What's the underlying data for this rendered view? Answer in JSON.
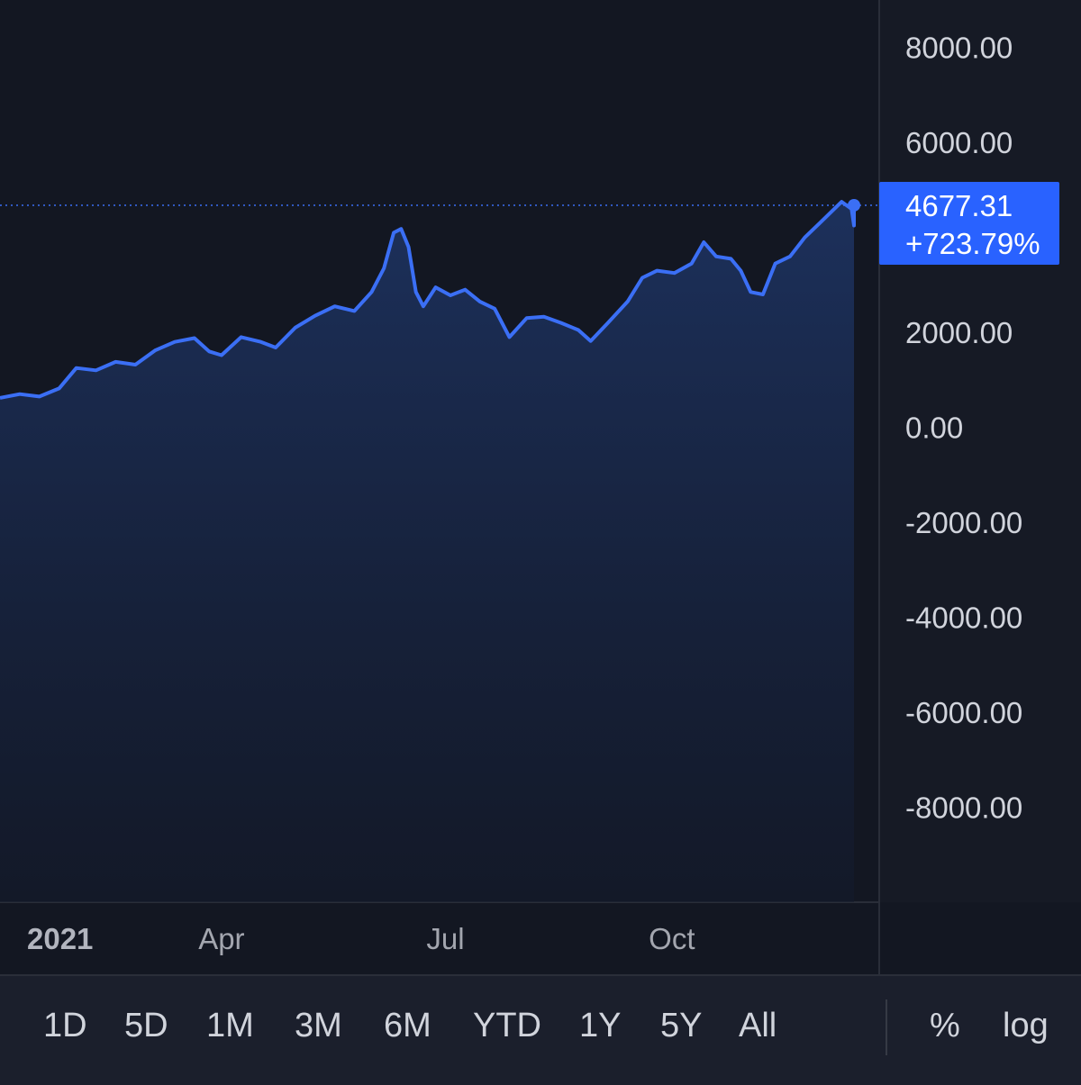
{
  "chart_data": {
    "type": "area",
    "x_start": "2021-01-01",
    "x_end": "2021-12-14",
    "ylim": [
      -10000,
      9000
    ],
    "y_ticks": [
      "8000.00",
      "6000.00",
      "2000.00",
      "0.00",
      "-2000.00",
      "-4000.00",
      "-6000.00",
      "-8000.00"
    ],
    "y_tick_values": [
      8000,
      6000,
      2000,
      0,
      -2000,
      -4000,
      -6000,
      -8000
    ],
    "x_ticks": [
      {
        "label": "2021",
        "date": "2021-01-01",
        "bold": true
      },
      {
        "label": "Apr",
        "date": "2021-04-01",
        "bold": false
      },
      {
        "label": "Jul",
        "date": "2021-07-01",
        "bold": false
      },
      {
        "label": "Oct",
        "date": "2021-10-01",
        "bold": false
      }
    ],
    "series": [
      {
        "points": [
          [
            "2021-01-01",
            620
          ],
          [
            "2021-01-09",
            700
          ],
          [
            "2021-01-17",
            650
          ],
          [
            "2021-01-25",
            820
          ],
          [
            "2021-02-01",
            1250
          ],
          [
            "2021-02-09",
            1200
          ],
          [
            "2021-02-17",
            1380
          ],
          [
            "2021-02-25",
            1320
          ],
          [
            "2021-03-05",
            1620
          ],
          [
            "2021-03-13",
            1800
          ],
          [
            "2021-03-21",
            1880
          ],
          [
            "2021-03-27",
            1600
          ],
          [
            "2021-04-01",
            1520
          ],
          [
            "2021-04-09",
            1900
          ],
          [
            "2021-04-17",
            1800
          ],
          [
            "2021-04-23",
            1680
          ],
          [
            "2021-05-01",
            2100
          ],
          [
            "2021-05-09",
            2350
          ],
          [
            "2021-05-17",
            2550
          ],
          [
            "2021-05-25",
            2450
          ],
          [
            "2021-06-01",
            2850
          ],
          [
            "2021-06-06",
            3350
          ],
          [
            "2021-06-10",
            4100
          ],
          [
            "2021-06-13",
            4180
          ],
          [
            "2021-06-16",
            3800
          ],
          [
            "2021-06-19",
            2850
          ],
          [
            "2021-06-22",
            2550
          ],
          [
            "2021-06-27",
            2950
          ],
          [
            "2021-07-03",
            2780
          ],
          [
            "2021-07-09",
            2900
          ],
          [
            "2021-07-15",
            2650
          ],
          [
            "2021-07-21",
            2500
          ],
          [
            "2021-07-27",
            1900
          ],
          [
            "2021-08-03",
            2300
          ],
          [
            "2021-08-10",
            2330
          ],
          [
            "2021-08-17",
            2200
          ],
          [
            "2021-08-24",
            2050
          ],
          [
            "2021-08-29",
            1820
          ],
          [
            "2021-09-05",
            2200
          ],
          [
            "2021-09-13",
            2650
          ],
          [
            "2021-09-19",
            3150
          ],
          [
            "2021-09-25",
            3300
          ],
          [
            "2021-10-02",
            3250
          ],
          [
            "2021-10-09",
            3450
          ],
          [
            "2021-10-14",
            3900
          ],
          [
            "2021-10-19",
            3600
          ],
          [
            "2021-10-25",
            3550
          ],
          [
            "2021-10-29",
            3300
          ],
          [
            "2021-11-02",
            2850
          ],
          [
            "2021-11-07",
            2800
          ],
          [
            "2021-11-12",
            3450
          ],
          [
            "2021-11-18",
            3600
          ],
          [
            "2021-11-24",
            4000
          ],
          [
            "2021-11-30",
            4300
          ],
          [
            "2021-12-05",
            4550
          ],
          [
            "2021-12-09",
            4750
          ],
          [
            "2021-12-13",
            4600
          ],
          [
            "2021-12-17",
            4250
          ],
          [
            "2021-12-21",
            4350
          ],
          [
            "2021-12-25",
            4500
          ],
          [
            "2021-12-29",
            4677.31
          ]
        ]
      }
    ],
    "last_value": "4677.31",
    "last_change": "+723.79%",
    "line_color": "#3b6ff5",
    "grid": false,
    "legend": "none"
  },
  "toolbar": {
    "ranges": [
      "1D",
      "5D",
      "1M",
      "3M",
      "6M",
      "YTD",
      "1Y",
      "5Y",
      "All"
    ],
    "percent_label": "%",
    "log_label": "log"
  },
  "colors": {
    "background": "#131722",
    "axis_text": "#d1d4dc",
    "price_label_bg": "#2962ff",
    "line": "#3b6ff5"
  }
}
